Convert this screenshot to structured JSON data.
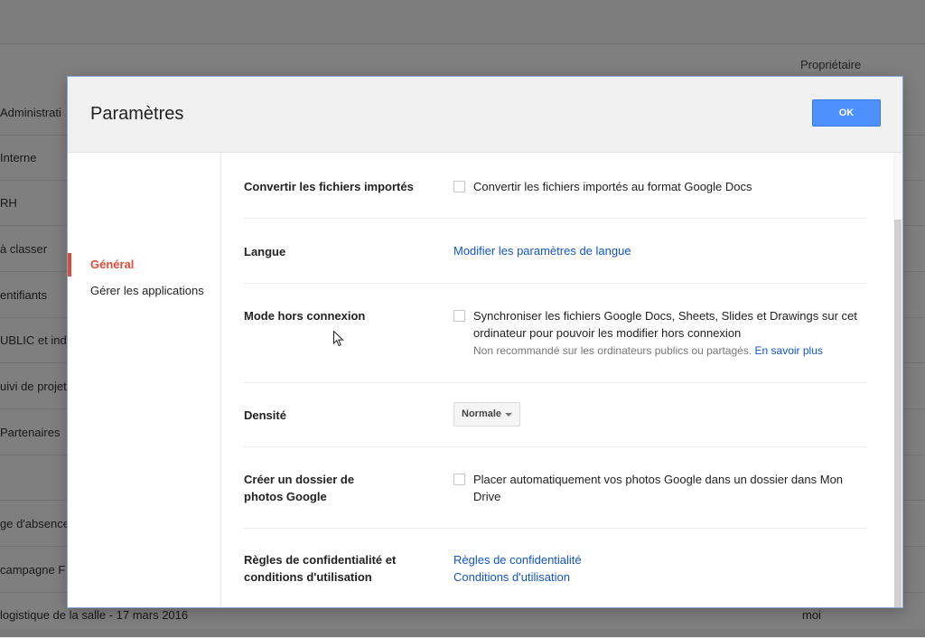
{
  "background": {
    "owner_header": "Propriétaire",
    "rows": [
      {
        "name": "Administrati",
        "owner": ""
      },
      {
        "name": "Interne",
        "owner": ""
      },
      {
        "name": "RH",
        "owner": ""
      },
      {
        "name": "à classer",
        "owner": ""
      },
      {
        "name": "entifiants",
        "owner": ""
      },
      {
        "name": "UBLIC et ind",
        "owner": ""
      },
      {
        "name": "uivi de projet",
        "owner": ""
      },
      {
        "name": "Partenaires",
        "owner": ""
      },
      {
        "name": "",
        "owner": ""
      },
      {
        "name": "ge d'absence",
        "owner": ""
      },
      {
        "name": "campagne F",
        "owner": ""
      },
      {
        "name": "logistique de la salle - 17 mars 2016",
        "owner": "moi"
      }
    ]
  },
  "dialog": {
    "title": "Paramètres",
    "ok_label": "OK"
  },
  "sidebar": {
    "items": [
      {
        "label": "Général",
        "active": true
      },
      {
        "label": "Gérer les applications",
        "active": false
      }
    ]
  },
  "settings": {
    "convert": {
      "label": "Convertir les fichiers importés",
      "checkbox_text": "Convertir les fichiers importés au format Google Docs"
    },
    "language": {
      "label": "Langue",
      "link": "Modifier les paramètres de langue"
    },
    "offline": {
      "label": "Mode hors connexion",
      "checkbox_text": "Synchroniser les fichiers Google Docs, Sheets, Slides et Drawings sur cet ordinateur pour pouvoir les modifier hors connexion",
      "hint": "Non recommandé sur les ordinateurs publics ou partagés.",
      "hint_link": "En savoir plus"
    },
    "density": {
      "label": "Densité",
      "selected": "Normale"
    },
    "photos": {
      "label_line1": "Créer un dossier de",
      "label_line2": "photos Google",
      "checkbox_text": "Placer automatiquement vos photos Google dans un dossier dans Mon Drive"
    },
    "privacy": {
      "label_line1": "Règles de confidentialité et",
      "label_line2": "conditions d'utilisation",
      "link_privacy": "Règles de confidentialité",
      "link_terms": "Conditions d'utilisation"
    }
  },
  "colors": {
    "accent": "#dd4b39",
    "primary_button": "#4d90fe",
    "link": "#1155cc"
  }
}
